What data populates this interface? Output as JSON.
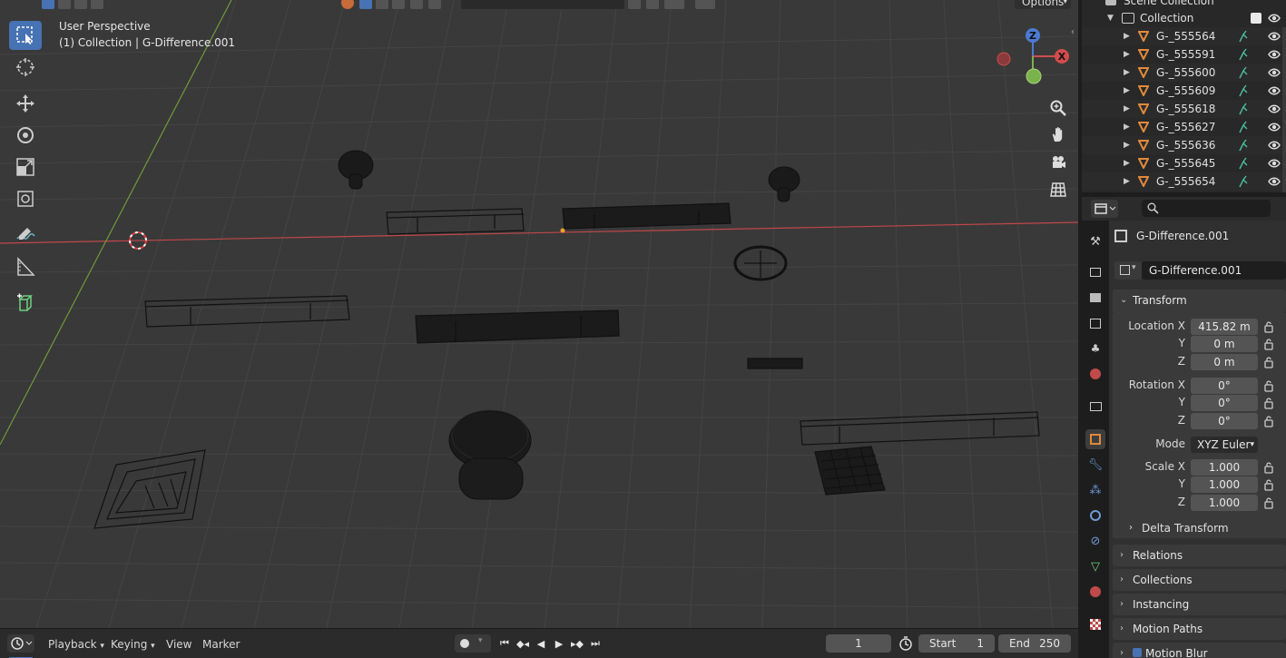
{
  "header": {
    "options_label": "Options"
  },
  "viewport": {
    "perspective_label": "User Perspective",
    "context_label": "(1) Collection | G-Difference.001",
    "gizmo_axes": {
      "z": "Z",
      "x": "X"
    }
  },
  "timeline": {
    "playback_label": "Playback",
    "keying_label": "Keying",
    "view_label": "View",
    "marker_label": "Marker",
    "current_frame": "1",
    "start_label": "Start",
    "start_value": "1",
    "end_label": "End",
    "end_value": "250"
  },
  "outliner": {
    "scene_collection_label": "Scene Collection",
    "collection_label": "Collection",
    "objects": [
      {
        "name": "G-_555564"
      },
      {
        "name": "G-_555591"
      },
      {
        "name": "G-_555600"
      },
      {
        "name": "G-_555609"
      },
      {
        "name": "G-_555618"
      },
      {
        "name": "G-_555627"
      },
      {
        "name": "G-_555636"
      },
      {
        "name": "G-_555645"
      },
      {
        "name": "G-_555654"
      }
    ]
  },
  "properties": {
    "object_title": "G-Difference.001",
    "object_name_field": "G-Difference.001",
    "transform_label": "Transform",
    "location": {
      "label_x": "Location X",
      "label_y": "Y",
      "label_z": "Z",
      "x": "415.82 m",
      "y": "0 m",
      "z": "0 m"
    },
    "rotation": {
      "label_x": "Rotation X",
      "label_y": "Y",
      "label_z": "Z",
      "x": "0°",
      "y": "0°",
      "z": "0°"
    },
    "mode_label": "Mode",
    "mode_value": "XYZ Euler",
    "scale": {
      "label_x": "Scale X",
      "label_y": "Y",
      "label_z": "Z",
      "x": "1.000",
      "y": "1.000",
      "z": "1.000"
    },
    "panels": {
      "delta_transform": "Delta Transform",
      "relations": "Relations",
      "collections": "Collections",
      "instancing": "Instancing",
      "motion_paths": "Motion Paths",
      "motion_blur": "Motion Blur"
    }
  },
  "colors": {
    "viewport_bg": "#393939",
    "grid_line": "#474747",
    "x_axis": "#c2474a",
    "y_axis": "#6f9a3a",
    "accent": "#4772b3",
    "mesh_icon": "#e08a3c"
  }
}
